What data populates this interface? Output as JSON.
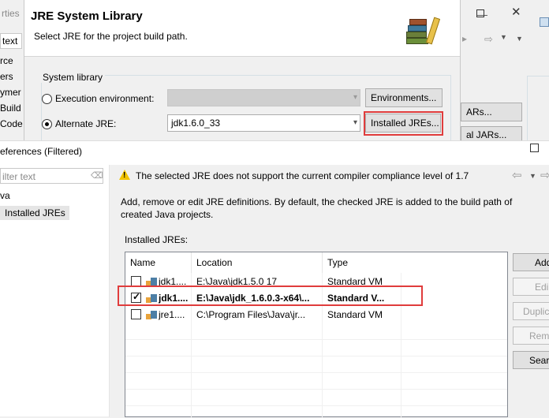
{
  "background_window": {
    "left_items": [
      "rties",
      "text",
      "rce",
      "ers",
      "ymer",
      "Build",
      "Code"
    ],
    "right_buttons": [
      "ARs...",
      "al JARs..."
    ]
  },
  "jre_dialog": {
    "title": "JRE System Library",
    "description": "Select JRE for the project build path.",
    "group_label": "System library",
    "exec_env_label": "Execution environment:",
    "exec_env_value": "",
    "environments_button": "Environments...",
    "alt_jre_label": "Alternate JRE:",
    "alt_jre_value": "jdk1.6.0_33",
    "installed_jres_button": "Installed JREs..."
  },
  "preferences": {
    "title": "eferences (Filtered)",
    "filter_placeholder": "ilter text",
    "tree": [
      {
        "label": "va",
        "selected": false
      },
      {
        "label": "Installed JREs",
        "selected": true
      }
    ],
    "warning_message": "The selected JRE does not support the current compiler compliance level of 1.7",
    "description_line1": "Add, remove or edit JRE definitions. By default, the checked JRE is added to the build path of",
    "description_line2": "created Java projects.",
    "table_label": "Installed JREs:",
    "columns": [
      "Name",
      "Location",
      "Type"
    ],
    "rows": [
      {
        "checked": false,
        "bold": false,
        "name": "jdk1....",
        "location": "E:\\Java\\jdk1.5.0 17",
        "type": "Standard VM"
      },
      {
        "checked": true,
        "bold": true,
        "name": "jdk1....",
        "location": "E:\\Java\\jdk_1.6.0.3-x64\\...",
        "type": "Standard V..."
      },
      {
        "checked": false,
        "bold": false,
        "name": "jre1....",
        "location": "C:\\Program Files\\Java\\jr...",
        "type": "Standard VM"
      }
    ],
    "side_buttons": [
      {
        "label": "Add",
        "enabled": true
      },
      {
        "label": "Edi",
        "enabled": false
      },
      {
        "label": "Duplic",
        "enabled": false
      },
      {
        "label": "Rem",
        "enabled": false
      },
      {
        "label": "Sear",
        "enabled": true
      }
    ]
  },
  "colors": {
    "highlight_red": "#e03c3c",
    "selected_tree_bg": "#e5e5e5",
    "warning_yellow": "#f2c400"
  }
}
